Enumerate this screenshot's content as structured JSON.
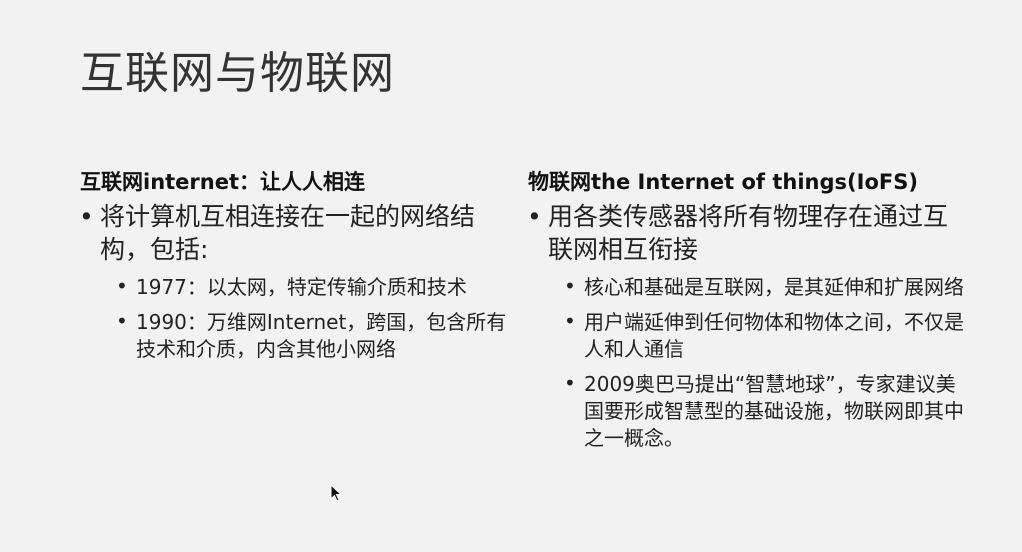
{
  "slide": {
    "title": "互联网与物联网",
    "left": {
      "heading": "互联网internet：让人人相连",
      "bullet": "将计算机互相连接在一起的网络结构，包括:",
      "sub": [
        "1977：以太网，特定传输介质和技术",
        "1990：万维网Internet，跨国，包含所有技术和介质，内含其他小网络"
      ]
    },
    "right": {
      "heading": "物联网the Internet of things(IoFS)",
      "bullet": "用各类传感器将所有物理存在通过互联网相互衔接",
      "sub": [
        "核心和基础是互联网，是其延伸和扩展网络",
        "用户端延伸到任何物体和物体之间，不仅是人和人通信",
        "2009奥巴马提出“智慧地球”，专家建议美国要形成智慧型的基础设施，物联网即其中之一概念。"
      ]
    },
    "bullet_char": "•"
  },
  "colors": {
    "background": "#f2f2f2",
    "text": "#222222"
  },
  "icons": {
    "cursor": "mouse-pointer-icon"
  }
}
